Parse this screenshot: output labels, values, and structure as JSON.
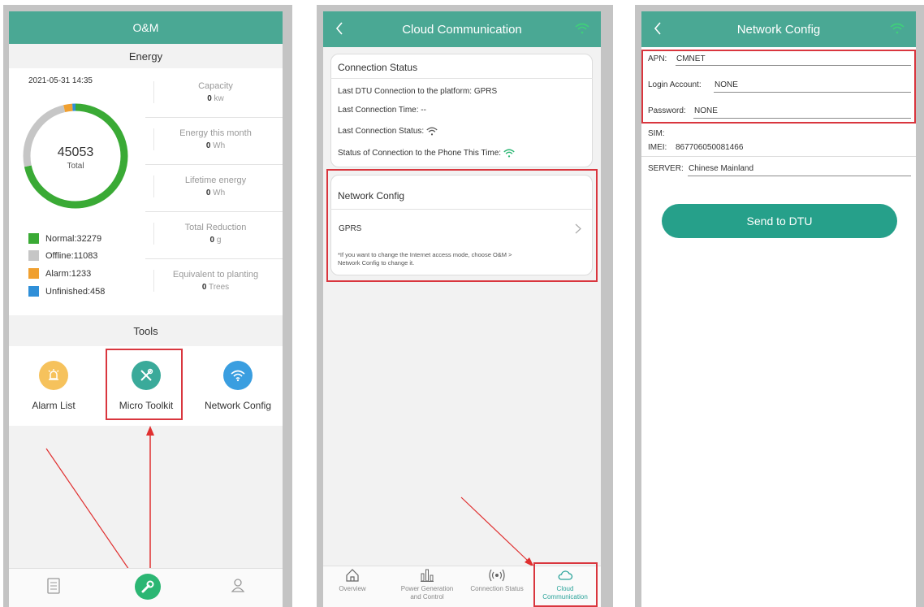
{
  "screen1": {
    "title": "O&M",
    "energy_header": "Energy",
    "timestamp": "2021-05-31 14:35",
    "donut": {
      "total": "45053",
      "total_label": "Total",
      "segments": [
        {
          "name": "Normal",
          "value": 32279,
          "color": "#3aaa35"
        },
        {
          "name": "Offline",
          "value": 11083,
          "color": "#c6c6c6"
        },
        {
          "name": "Alarm",
          "value": 1233,
          "color": "#f0a030"
        },
        {
          "name": "Unfinished",
          "value": 458,
          "color": "#2f8fd8"
        }
      ]
    },
    "stats": [
      {
        "label": "Capacity",
        "value": "0",
        "unit": "kw"
      },
      {
        "label": "Energy this month",
        "value": "0",
        "unit": "Wh"
      },
      {
        "label": "Lifetime energy",
        "value": "0",
        "unit": "Wh"
      },
      {
        "label": "Total Reduction",
        "value": "0",
        "unit": "g"
      },
      {
        "label": "Equivalent to planting",
        "value": "0",
        "unit": "Trees"
      }
    ],
    "legend": [
      {
        "label": "Normal: ",
        "value": "32279",
        "color": "#3aaa35"
      },
      {
        "label": "Offline: ",
        "value": "11083",
        "color": "#c6c6c6"
      },
      {
        "label": "Alarm: ",
        "value": "1233",
        "color": "#f0a030"
      },
      {
        "label": "Unfinished: ",
        "value": "458",
        "color": "#2f8fd8"
      }
    ],
    "tools_header": "Tools",
    "tools": [
      {
        "label": "Alarm List",
        "icon": "alarm-icon",
        "color": "#f6c25c"
      },
      {
        "label": "Micro Toolkit",
        "icon": "tools-icon",
        "color": "#3aaa9a"
      },
      {
        "label": "Network Config",
        "icon": "wifi-icon",
        "color": "#3a9ee0"
      }
    ],
    "bottom_nav": [
      "document-icon",
      "wrench-icon",
      "user-icon"
    ]
  },
  "screen2": {
    "title": "Cloud Communication",
    "conn_status": {
      "title": "Connection Status",
      "last_dtu": "Last DTU Connection to the platform: GPRS",
      "last_time": "Last Connection Time: --",
      "last_status": "Last Connection Status:",
      "phone_status": "Status of Connection to the Phone This Time:"
    },
    "network": {
      "title": "Network Config",
      "mode": "GPRS",
      "note_line1": "*If you want to change the Internet access mode, choose O&M >",
      "note_line2": "Network Config to change it."
    },
    "tabs": [
      {
        "label1": "Overview",
        "label2": "",
        "icon": "home-icon"
      },
      {
        "label1": "Power Generation",
        "label2": "and Control",
        "icon": "bars-icon"
      },
      {
        "label1": "Connection Status",
        "label2": "",
        "icon": "signal-icon"
      },
      {
        "label1": "Cloud",
        "label2": "Communication",
        "icon": "cloud-icon"
      }
    ]
  },
  "screen3": {
    "title": "Network Config",
    "apn_label": "APN:",
    "apn_value": "CMNET",
    "login_label": "Login Account:",
    "login_value": "NONE",
    "password_label": "Password:",
    "password_value": "NONE",
    "sim_label": "SIM:",
    "imei_label": "IMEI:",
    "imei_value": "867706050081466",
    "server_label": "SERVER:",
    "server_value": "Chinese Mainland",
    "send_button": "Send to DTU"
  },
  "colors": {
    "header_teal": "#4aa894",
    "accent_green": "#2bb673",
    "highlight_red": "#d9363e",
    "button_teal": "#26a08a"
  }
}
